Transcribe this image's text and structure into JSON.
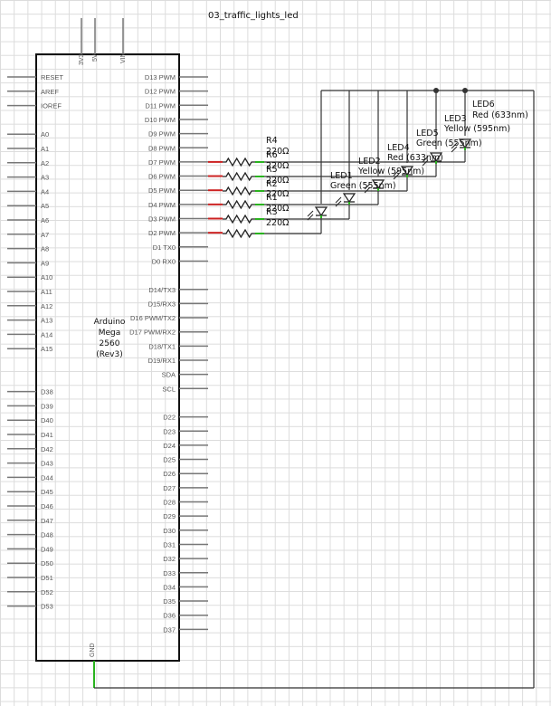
{
  "title": "03_traffic_lights_led",
  "board": {
    "lines": [
      "Arduino",
      "Mega",
      "2560",
      "(Rev3)"
    ],
    "top_pins": [
      "3V3",
      "5V",
      "VIN"
    ],
    "bottom_pin": "GND",
    "left_pins": [
      "RESET",
      "AREF",
      "IOREF",
      "",
      "A0",
      "A1",
      "A2",
      "A3",
      "A4",
      "A5",
      "A6",
      "A7",
      "A8",
      "A9",
      "A10",
      "A11",
      "A12",
      "A13",
      "A14",
      "A15",
      "",
      "",
      "D38",
      "D39",
      "D40",
      "D41",
      "D42",
      "D43",
      "D44",
      "D45",
      "D46",
      "D47",
      "D48",
      "D49",
      "D50",
      "D51",
      "D52",
      "D53"
    ],
    "right_pins": [
      "D13 PWM",
      "D12 PWM",
      "D11 PWM",
      "D10 PWM",
      "D9 PWM",
      "D8 PWM",
      "D7 PWM",
      "D6 PWM",
      "D5 PWM",
      "D4 PWM",
      "D3 PWM",
      "D2 PWM",
      "D1 TX0",
      "D0 RX0",
      "",
      "D14/TX3",
      "D15/RX3",
      "D16 PWM/TX2",
      "D17 PWM/RX2",
      "D18/TX1",
      "D19/RX1",
      "SDA",
      "SCL",
      "",
      "D22",
      "D23",
      "D24",
      "D25",
      "D26",
      "D27",
      "D28",
      "D29",
      "D30",
      "D31",
      "D32",
      "D33",
      "D34",
      "D35",
      "D36",
      "D37"
    ]
  },
  "resistors": [
    {
      "name": "R4",
      "value": "220Ω"
    },
    {
      "name": "R6",
      "value": "220Ω"
    },
    {
      "name": "R5",
      "value": "220Ω"
    },
    {
      "name": "R2",
      "value": "220Ω"
    },
    {
      "name": "R1",
      "value": "220Ω"
    },
    {
      "name": "R3",
      "value": "220Ω"
    }
  ],
  "leds": [
    {
      "name": "LED1",
      "color": "Green (555nm)"
    },
    {
      "name": "LED2",
      "color": "Yellow (595nm)"
    },
    {
      "name": "LED4",
      "color": "Red (633nm)"
    },
    {
      "name": "LED5",
      "color": "Green (555nm)"
    },
    {
      "name": "LED3",
      "color": "Yellow (595nm)"
    },
    {
      "name": "LED6",
      "color": "Red (633nm)"
    }
  ],
  "colors": {
    "wire": "#333333",
    "pin_active": "#29b31e",
    "pin_signal": "#cc2222",
    "grid": "#dcdcdc"
  }
}
